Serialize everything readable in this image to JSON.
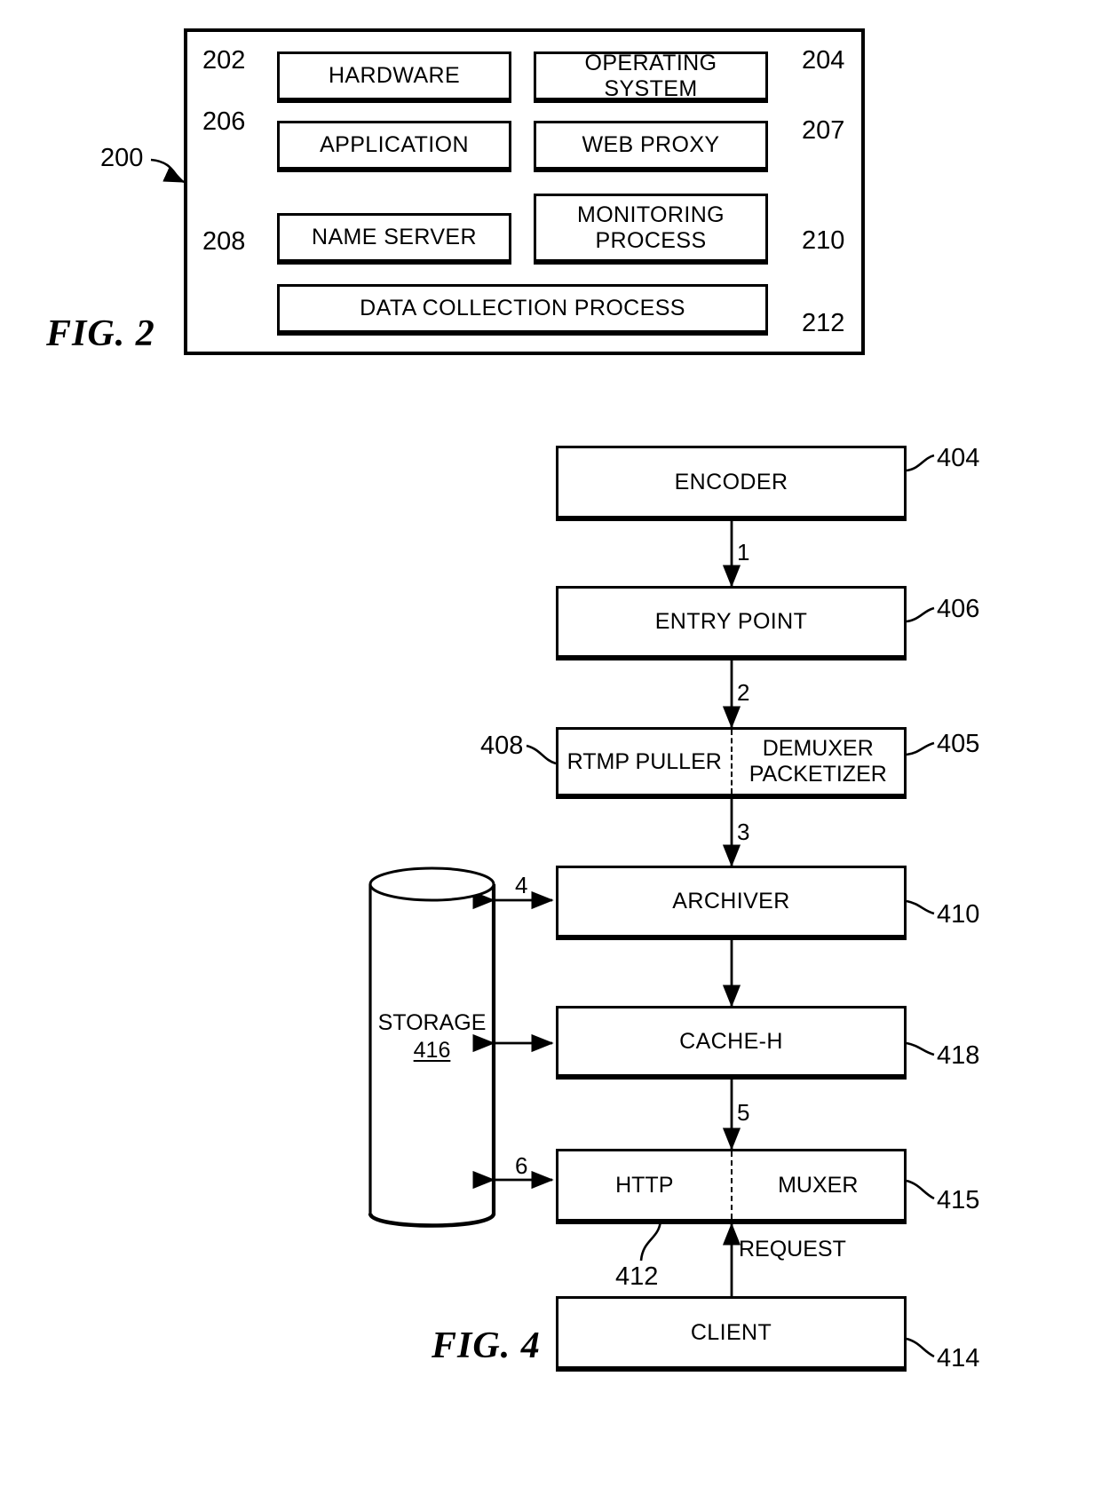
{
  "document": {
    "type": "patent-drawing-sheet",
    "figures": [
      {
        "id": "fig2",
        "label": "FIG. 2",
        "frame_ref": "200",
        "boxes": [
          {
            "ref": "202",
            "label": "HARDWARE"
          },
          {
            "ref": "204",
            "label": "OPERATING SYSTEM"
          },
          {
            "ref": "206",
            "label": "APPLICATION"
          },
          {
            "ref": "207",
            "label": "WEB PROXY"
          },
          {
            "ref": "208",
            "label": "NAME SERVER"
          },
          {
            "ref": "210",
            "label": "MONITORING PROCESS",
            "line1": "MONITORING",
            "line2": "PROCESS"
          },
          {
            "ref": "212",
            "label": "DATA COLLECTION PROCESS"
          }
        ]
      },
      {
        "id": "fig4",
        "label": "FIG. 4",
        "boxes": [
          {
            "ref": "404",
            "label": "ENCODER"
          },
          {
            "ref": "406",
            "label": "ENTRY POINT"
          },
          {
            "ref": "408",
            "label": "RTMP PULLER"
          },
          {
            "ref": "405",
            "label": "DEMUXER PACKETIZER",
            "line1": "DEMUXER",
            "line2": "PACKETIZER"
          },
          {
            "ref": "410",
            "label": "ARCHIVER"
          },
          {
            "ref": "418",
            "label": "CACHE-H"
          },
          {
            "ref": "412",
            "label": "HTTP"
          },
          {
            "ref": "415",
            "label": "MUXER"
          },
          {
            "ref": "414",
            "label": "CLIENT"
          }
        ],
        "storage": {
          "ref": "416",
          "label": "STORAGE"
        },
        "flow_numbers": [
          "1",
          "2",
          "3",
          "4",
          "5",
          "6"
        ],
        "edge_labels": [
          "REQUEST"
        ]
      }
    ]
  },
  "fig2": {
    "fig_label": "FIG. 2",
    "ref_200": "200",
    "ref_202": "202",
    "ref_204": "204",
    "ref_206": "206",
    "ref_207": "207",
    "ref_208": "208",
    "ref_210": "210",
    "ref_212": "212",
    "hardware": "HARDWARE",
    "operating_system": "OPERATING SYSTEM",
    "application": "APPLICATION",
    "web_proxy": "WEB PROXY",
    "name_server": "NAME SERVER",
    "monitoring_line1": "MONITORING",
    "monitoring_line2": "PROCESS",
    "data_collection": "DATA COLLECTION PROCESS"
  },
  "fig4": {
    "fig_label": "FIG. 4",
    "ref_404": "404",
    "ref_406": "406",
    "ref_408": "408",
    "ref_405": "405",
    "ref_410": "410",
    "ref_418": "418",
    "ref_412": "412",
    "ref_415": "415",
    "ref_414": "414",
    "encoder": "ENCODER",
    "entry_point": "ENTRY POINT",
    "rtmp_puller": "RTMP PULLER",
    "demuxer_line1": "DEMUXER",
    "demuxer_line2": "PACKETIZER",
    "archiver": "ARCHIVER",
    "cache_h": "CACHE-H",
    "http": "HTTP",
    "muxer": "MUXER",
    "client": "CLIENT",
    "storage_label": "STORAGE",
    "storage_ref": "416",
    "num_1": "1",
    "num_2": "2",
    "num_3": "3",
    "num_4": "4",
    "num_5": "5",
    "num_6": "6",
    "request_label": "REQUEST"
  }
}
